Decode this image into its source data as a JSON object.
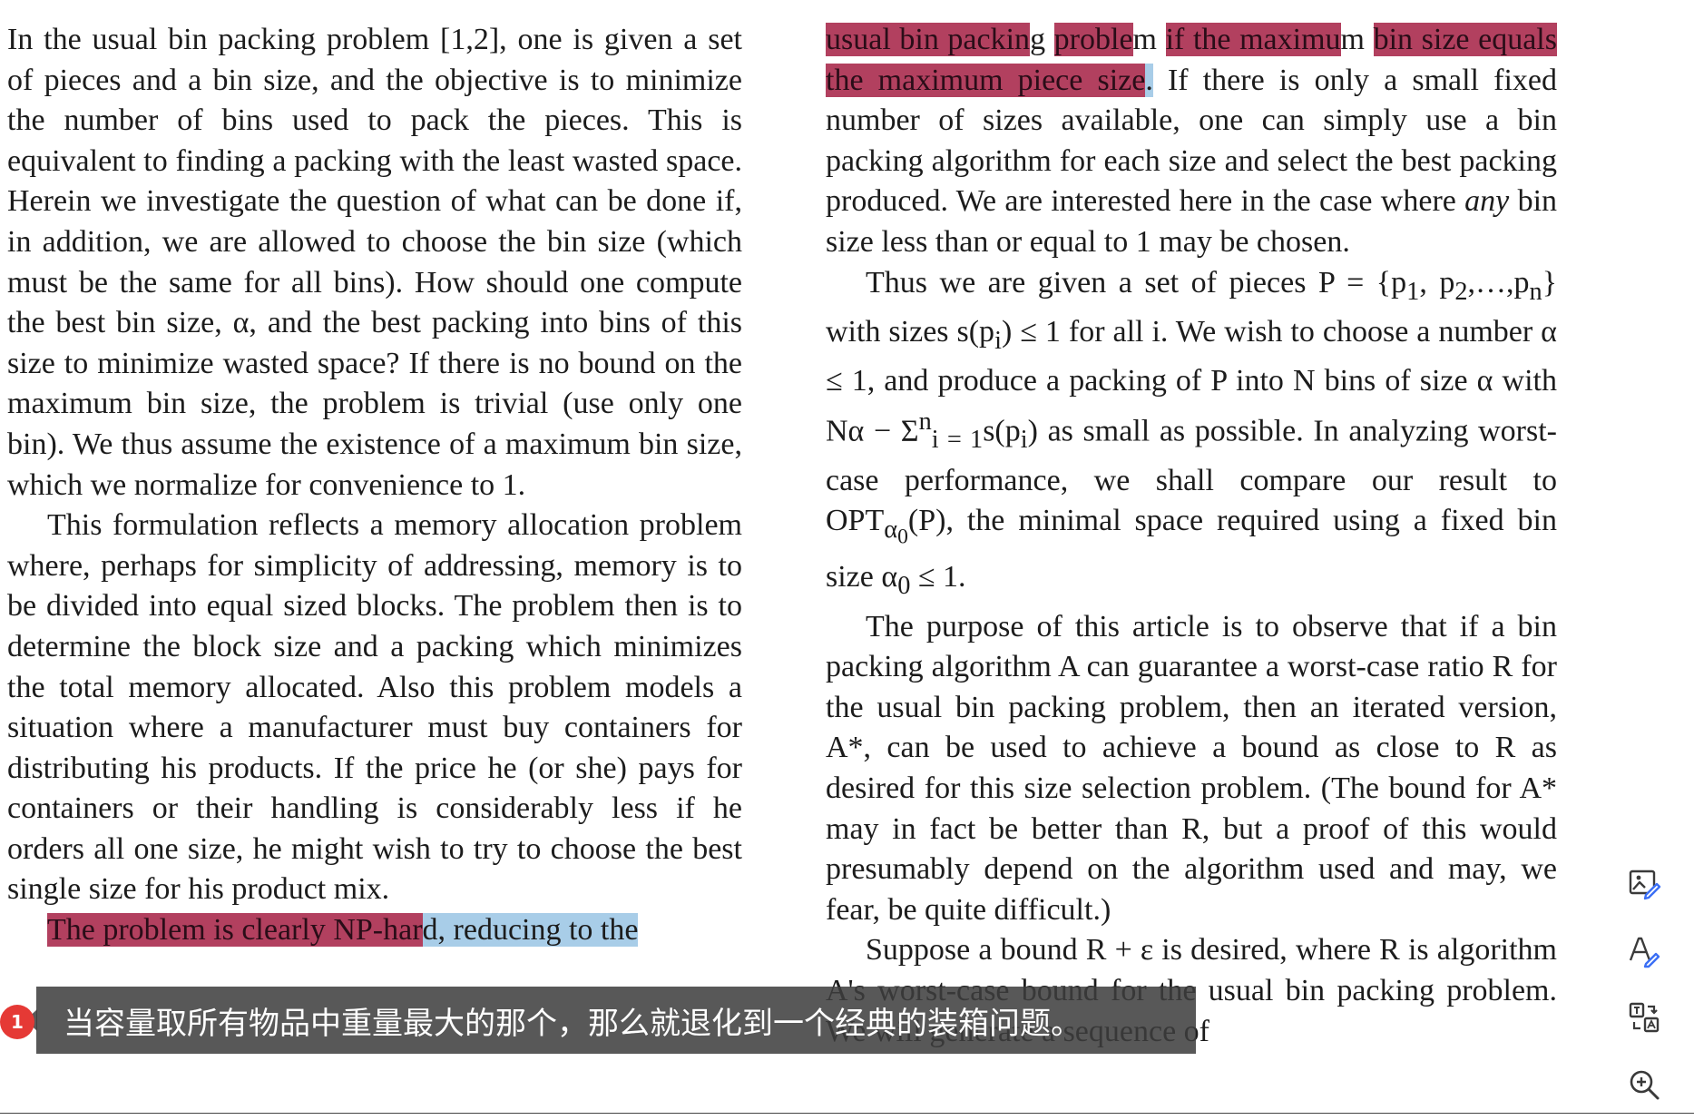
{
  "document": {
    "left_column": {
      "p1": "In the usual bin packing problem [1,2], one is given a set of pieces and a bin size, and the objective is to minimize the number of bins used to pack the pieces. This is equivalent to finding a packing with the least wasted space. Herein we investigate the question of what can be done if, in addition, we are allowed to choose the bin size (which must be the same for all bins). How should one compute the best bin size, α, and the best packing into bins of this size to minimize wasted space? If there is no bound on the maximum bin size, the problem is trivial (use only one bin). We thus assume the existence of a maximum bin size, which we normalize for convenience to 1.",
      "p2": "This formulation reflects a memory allocation problem where, perhaps for simplicity of addressing, memory is to be divided into equal sized blocks. The problem then is to determine the block size and a packing which minimizes the total memory allocated. Also this problem models a situation where a manufacturer must buy containers for distributing his products. If the price he (or she) pays for containers or their handling is considerably less if he orders all one size, he might wish to try to choose the best single size for his product mix.",
      "p3_highlight_red": "The problem is clearly NP-har",
      "p3_highlight_blue": "d, reducing to the"
    },
    "right_column": {
      "p0_hl": [
        {
          "text": "usual bin packin",
          "hl": "red"
        },
        {
          "text": "g ",
          "hl": "none"
        },
        {
          "text": "proble",
          "hl": "red"
        },
        {
          "text": "m ",
          "hl": "none"
        },
        {
          "text": "if the maximu",
          "hl": "red"
        },
        {
          "text": "m ",
          "hl": "none"
        },
        {
          "text": "bin size equals the maximum piece size",
          "hl": "red"
        },
        {
          "text": ".",
          "hl": "blue"
        }
      ],
      "p0_rest": " If there is only a small fixed number of sizes available, one can simply use a bin packing algorithm for each size and select the best packing produced. We are interested here in the case where",
      "p0_italic": "any",
      "p0_end": "bin size less than or equal to 1 may be chosen.",
      "p1_a": "Thus we are given a set of pieces P = {p",
      "p1_b": ", p",
      "p1_c": ",…,p",
      "p1_d": "} with sizes s(p",
      "p1_e": ") ≤ 1 for all i. We wish to choose a number α ≤ 1, and produce a packing of P into N bins of size α with Nα − Σ",
      "p1_f": "s(p",
      "p1_g": ") as small as possible. In analyzing worst-case performance, we shall compare our result to OPT",
      "p1_h": "(P), the minimal space required using a fixed bin size α",
      "p1_i": " ≤ 1.",
      "sub_1": "1",
      "sub_2": "2",
      "sub_n": "n",
      "sub_i": "i",
      "sub_i_eq_1": "i = 1",
      "sup_n": "n",
      "sub_alpha0": "α",
      "sub_0": "0",
      "p2": "The purpose of this article is to observe that if a bin packing algorithm A can guarantee a worst-case ratio R for the usual bin packing problem, then an iterated version, A*, can be used to achieve a bound as close to R as desired for this size selection problem. (The bound for A* may in fact be better than R, but a proof of this would presumably depend on the algorithm used and may, we fear, be quite difficult.)",
      "p3": "Suppose a bound R + ε is desired, where R is algorithm A's worst-case bound for the usual bin packing problem. We will generate a sequence of"
    }
  },
  "subtitle": {
    "badge": "1",
    "text": "当容量取所有物品中重量最大的那个，那么就退化到一个经典的装箱问题。"
  },
  "toolbar": {
    "items": [
      {
        "name": "image-edit-icon"
      },
      {
        "name": "text-edit-icon"
      },
      {
        "name": "translate-icon"
      },
      {
        "name": "zoom-in-icon"
      }
    ]
  },
  "colors": {
    "highlight_red": "#b2405f",
    "highlight_blue": "#a8cde8",
    "subtitle_bg": "#3c3c3c",
    "badge": "#e53935"
  }
}
